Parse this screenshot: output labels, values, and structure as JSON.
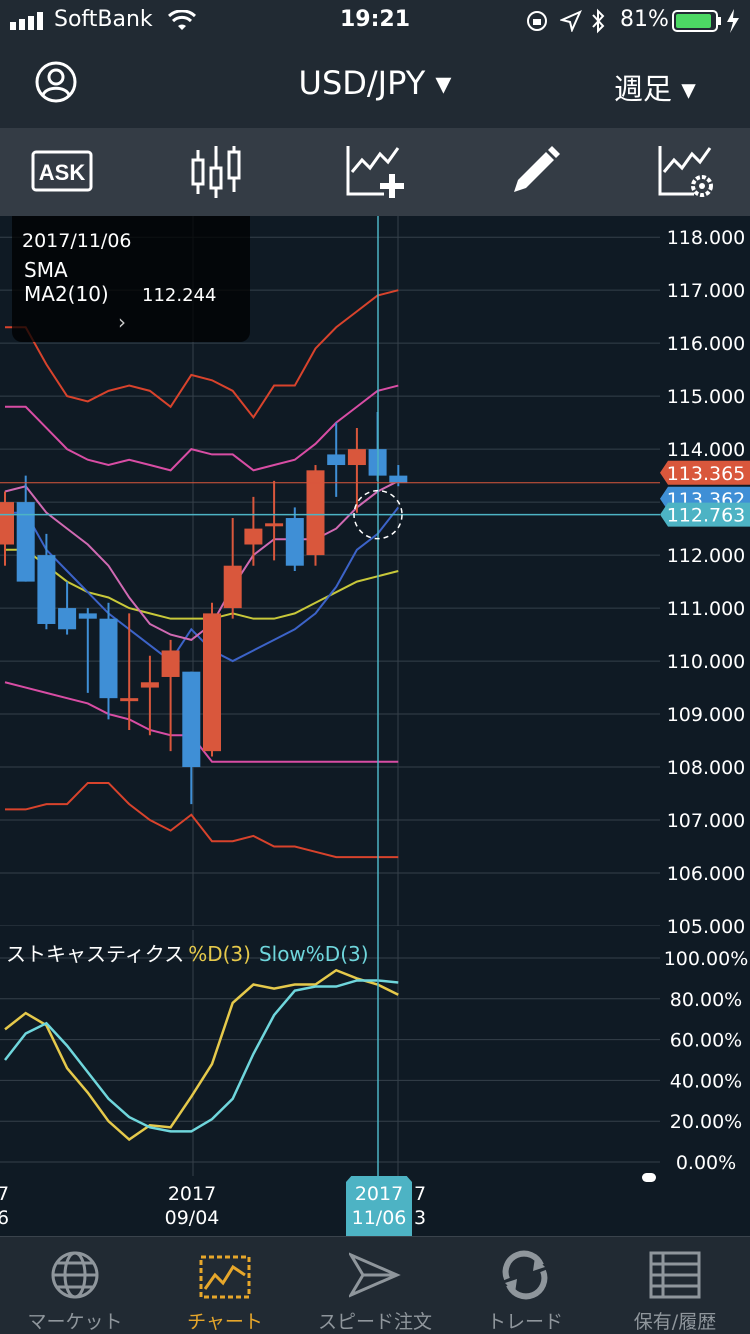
{
  "status_bar": {
    "carrier": "SoftBank",
    "time": "19:21",
    "battery": "81%"
  },
  "header": {
    "pair": "USD/JPY ▾",
    "period": "週足 ▾"
  },
  "toolbar": {
    "ask_label": "ASK"
  },
  "info_box": {
    "date": "2017/11/06",
    "indicator": "SMA",
    "ma_label": "MA2(10)",
    "ma_value": "112.244",
    "more": "›"
  },
  "price_axis": [
    "118.000",
    "117.000",
    "116.000",
    "115.000",
    "114.000",
    "113.000",
    "112.000",
    "111.000",
    "110.000",
    "109.000",
    "108.000",
    "107.000",
    "106.000",
    "105.000"
  ],
  "price_tags": {
    "ask": "113.365",
    "bid": "113.362",
    "cursor": "112.763"
  },
  "stoch": {
    "name": "ストキャスティクス",
    "d_label": "%D(3)",
    "slow_label": "Slow%D(3)",
    "axis": [
      "100.00%",
      "80.00%",
      "60.00%",
      "40.00%",
      "20.00%",
      "0.00%"
    ]
  },
  "dates": {
    "left_top": "7",
    "left_bottom": "6",
    "mid_year": "2017",
    "mid_date": "09/04",
    "cursor_year": "2017",
    "cursor_date": "11/06",
    "right_top": "7",
    "right_bottom": "3"
  },
  "tabs": [
    {
      "label": "マーケット"
    },
    {
      "label": "チャート"
    },
    {
      "label": "スピード注文"
    },
    {
      "label": "トレード"
    },
    {
      "label": "保有/履歴"
    }
  ],
  "colors": {
    "up": "#d9573c",
    "down": "#3f8fd6",
    "ask_tag": "#d9573c",
    "bid_tag": "#3f8fd6",
    "cursor_tag": "#4db3c4",
    "active_tab": "#e7a72b"
  },
  "chart_data": {
    "type": "candlestick",
    "y_range": [
      105,
      118.4
    ],
    "candles": [
      {
        "o": 112.2,
        "h": 113.2,
        "l": 111.8,
        "c": 113.0
      },
      {
        "o": 113.0,
        "h": 113.5,
        "l": 111.5,
        "c": 111.5
      },
      {
        "o": 112.0,
        "h": 112.4,
        "l": 110.6,
        "c": 110.7
      },
      {
        "o": 111.0,
        "h": 111.5,
        "l": 110.5,
        "c": 110.6
      },
      {
        "o": 110.9,
        "h": 111.0,
        "l": 109.4,
        "c": 110.8
      },
      {
        "o": 110.8,
        "h": 111.1,
        "l": 108.9,
        "c": 109.3
      },
      {
        "o": 109.3,
        "h": 110.9,
        "l": 108.7,
        "c": 109.3
      },
      {
        "o": 109.5,
        "h": 110.1,
        "l": 108.6,
        "c": 109.6
      },
      {
        "o": 109.7,
        "h": 110.4,
        "l": 108.3,
        "c": 110.2
      },
      {
        "o": 109.8,
        "h": 109.8,
        "l": 107.3,
        "c": 108.0
      },
      {
        "o": 108.3,
        "h": 111.1,
        "l": 108.2,
        "c": 110.9
      },
      {
        "o": 111.0,
        "h": 112.7,
        "l": 110.8,
        "c": 111.8
      },
      {
        "o": 112.2,
        "h": 113.1,
        "l": 111.8,
        "c": 112.5
      },
      {
        "o": 112.6,
        "h": 113.4,
        "l": 111.9,
        "c": 112.6
      },
      {
        "o": 112.7,
        "h": 112.9,
        "l": 111.7,
        "c": 111.8
      },
      {
        "o": 112.0,
        "h": 113.7,
        "l": 111.8,
        "c": 113.6
      },
      {
        "o": 113.9,
        "h": 114.5,
        "l": 113.1,
        "c": 113.7
      },
      {
        "o": 113.7,
        "h": 114.4,
        "l": 112.8,
        "c": 114.0
      },
      {
        "o": 114.0,
        "h": 114.7,
        "l": 113.4,
        "c": 113.5
      },
      {
        "o": 113.5,
        "h": 113.7,
        "l": 113.3,
        "c": 113.36
      }
    ],
    "bb_outer_upper": [
      116.3,
      116.3,
      115.6,
      115.0,
      114.9,
      115.1,
      115.2,
      115.1,
      114.8,
      115.4,
      115.3,
      115.1,
      114.6,
      115.2,
      115.2,
      115.9,
      116.3,
      116.6,
      116.9,
      117.0
    ],
    "bb_inner_upper": [
      114.8,
      114.8,
      114.4,
      114.0,
      113.8,
      113.7,
      113.8,
      113.7,
      113.6,
      114.0,
      113.9,
      113.9,
      113.6,
      113.7,
      113.8,
      114.1,
      114.5,
      114.8,
      115.1,
      115.2
    ],
    "bb_inner_lower": [
      109.6,
      109.5,
      109.4,
      109.3,
      109.2,
      109.0,
      108.9,
      108.7,
      108.6,
      108.6,
      108.1,
      108.1,
      108.1,
      108.1,
      108.1,
      108.1,
      108.1,
      108.1,
      108.1,
      108.1
    ],
    "bb_outer_lower": [
      107.2,
      107.2,
      107.3,
      107.3,
      107.7,
      107.7,
      107.3,
      107.0,
      106.8,
      107.1,
      106.6,
      106.6,
      106.7,
      106.5,
      106.5,
      106.4,
      106.3,
      106.3,
      106.3,
      106.3
    ],
    "middle": [
      112.1,
      112.1,
      111.8,
      111.5,
      111.3,
      111.2,
      111.0,
      110.9,
      110.8,
      110.8,
      110.8,
      110.9,
      110.8,
      110.8,
      110.9,
      111.1,
      111.3,
      111.5,
      111.6,
      111.7
    ],
    "ma_blue": [
      112.8,
      112.8,
      112.1,
      111.7,
      111.3,
      110.9,
      110.6,
      110.3,
      110.0,
      110.6,
      110.2,
      110.0,
      110.2,
      110.4,
      110.6,
      110.9,
      111.4,
      112.1,
      112.4,
      112.9
    ],
    "ma_pink": [
      113.2,
      113.3,
      112.8,
      112.5,
      112.2,
      111.8,
      111.2,
      110.7,
      110.5,
      110.4,
      110.7,
      111.4,
      112.0,
      112.3,
      112.3,
      112.3,
      112.5,
      112.9,
      113.2,
      113.4
    ],
    "stoch_d": [
      65,
      73,
      67,
      46,
      34,
      20,
      11,
      18,
      17,
      32,
      48,
      78,
      87,
      85,
      87,
      87,
      94,
      90,
      87,
      82
    ],
    "stoch_slow": [
      50,
      63,
      68,
      57,
      44,
      31,
      22,
      17,
      15,
      15,
      21,
      31,
      53,
      72,
      84,
      86,
      86,
      89,
      89,
      88
    ]
  }
}
